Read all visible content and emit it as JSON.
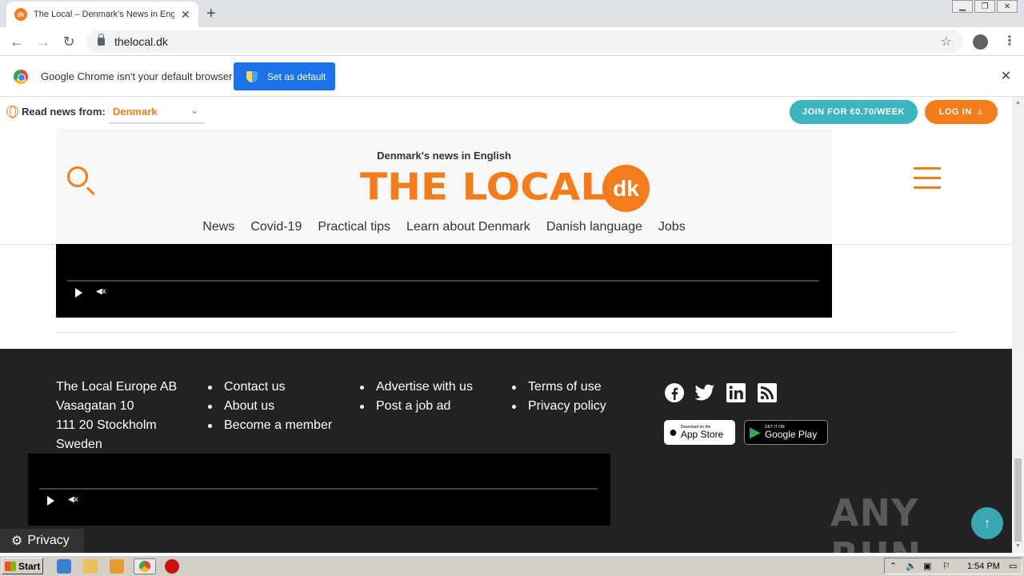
{
  "browser": {
    "tab_title": "The Local – Denmark's News in English",
    "tab_favicon": "dk",
    "url": "thelocal.dk",
    "infobar_text": "Google Chrome isn't your default browser",
    "infobar_button": "Set as default"
  },
  "site": {
    "read_from_label": "Read news from:",
    "country": "Denmark",
    "join_label": "JOIN FOR €0.70/WEEK",
    "login_label": "LOG IN",
    "tagline": "Denmark's news in English",
    "logo": "THE LOCAL",
    "logo_badge": "dk",
    "nav": [
      "News",
      "Covid-19",
      "Practical tips",
      "Learn about Denmark",
      "Danish language",
      "Jobs"
    ]
  },
  "footer": {
    "address": [
      "The Local Europe AB",
      "Vasagatan 10",
      "111 20 Stockholm",
      "Sweden"
    ],
    "col1": [
      "Contact us",
      "About us",
      "Become a member"
    ],
    "col2": [
      "Advertise with us",
      "Post a job ad"
    ],
    "col3": [
      "Terms of use",
      "Privacy policy"
    ],
    "social": [
      "facebook-icon",
      "twitter-icon",
      "linkedin-icon",
      "rss-icon"
    ],
    "appstore_small": "Download on the",
    "appstore_big": "App Store",
    "googleplay_small": "GET IT ON",
    "googleplay_big": "Google Play",
    "privacy_label": "Privacy",
    "watermark": "ANY RUN"
  },
  "taskbar": {
    "start_label": "Start",
    "clock": "1:54 PM"
  },
  "colors": {
    "brand_orange": "#f47c1b",
    "teal": "#3db5c0",
    "footer_bg": "#222222"
  }
}
